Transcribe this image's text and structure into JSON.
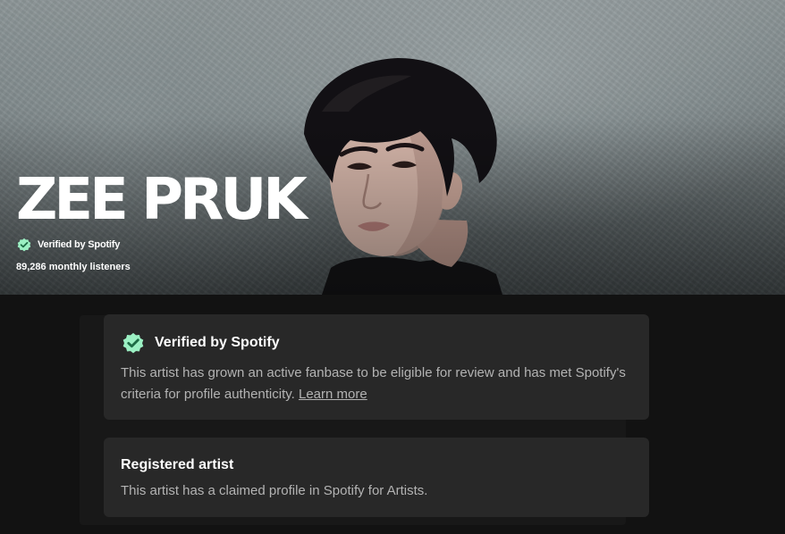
{
  "artist": {
    "name": "ZEE PRUK",
    "verified_label": "Verified by Spotify",
    "monthly_listeners": "89,286 monthly listeners"
  },
  "verified_card": {
    "title": "Verified by Spotify",
    "text": "This artist has grown an active fanbase to be eligible for review and has met Spotify's criteria for profile authenticity.",
    "link": "Learn more"
  },
  "registered_card": {
    "title": "Registered artist",
    "text": "This artist has a claimed profile in Spotify for Artists."
  },
  "colors": {
    "badge_green": "#9bf0c3",
    "card_bg": "#282828",
    "page_bg": "#121212"
  },
  "icons": {
    "verified": "verified-badge-icon"
  }
}
